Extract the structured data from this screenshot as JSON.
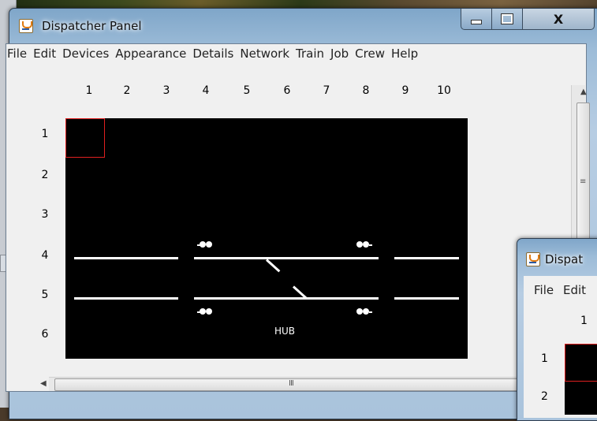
{
  "main_window": {
    "title": "Dispatcher Panel",
    "buttons": {
      "minimize": "minimize",
      "maximize": "maximize",
      "close": "X"
    },
    "menu": [
      "File",
      "Edit",
      "Devices",
      "Appearance",
      "Details",
      "Network",
      "Train",
      "Job",
      "Crew",
      "Help"
    ],
    "columns": [
      "1",
      "2",
      "3",
      "4",
      "5",
      "6",
      "7",
      "8",
      "9",
      "10"
    ],
    "rows": [
      "1",
      "2",
      "3",
      "4",
      "5",
      "6"
    ],
    "board_label": "HUB",
    "hscroll_grip": "III",
    "colors": {
      "board": "#000000",
      "selection": "#e02020",
      "track": "#ffffff"
    }
  },
  "second_window": {
    "title": "Dispatcher Panel",
    "title_visible": "Dispat",
    "menu": [
      "File",
      "Edit"
    ],
    "columns": [
      "1"
    ],
    "rows": [
      "1",
      "2"
    ]
  }
}
